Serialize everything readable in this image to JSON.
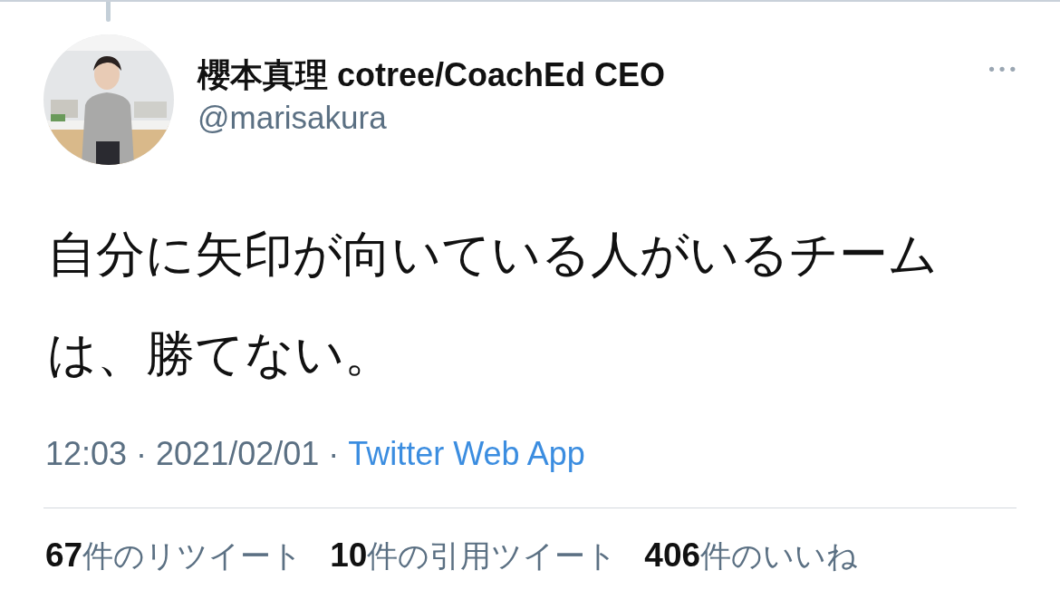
{
  "tweet": {
    "author": {
      "name": "櫻本真理 cotree/CoachEd CEO",
      "handle": "@marisakura"
    },
    "more": "•••",
    "text": "自分に矢印が向いている人がいるチームは、勝てない。",
    "time": "12:03 · 2021/02/01 ·",
    "source": "Twitter Web App",
    "stats": [
      {
        "text": "**67**件のリツイート"
      },
      {
        "text": "**10**件の引用ツイート"
      },
      {
        "text": "**406**件のいいね"
      }
    ]
  }
}
